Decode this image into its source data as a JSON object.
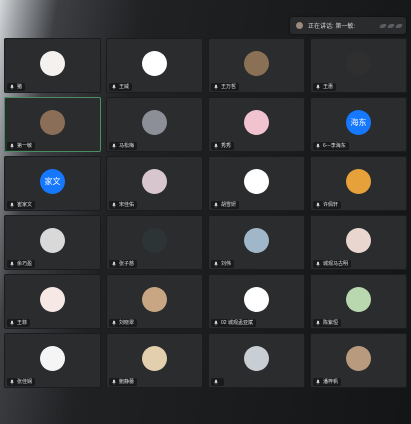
{
  "speaking_bar": {
    "text": "正在讲话: 第一敏:"
  },
  "tiles": [
    {
      "name": "猪",
      "avatar_color": "#f4f1ee",
      "avatar_text": "",
      "icon": "cartoon-girl-avatar-icon"
    },
    {
      "name": "王威",
      "avatar_color": "#ffffff",
      "avatar_text": "",
      "icon": "meh-face-avatar-icon"
    },
    {
      "name": "王万哲",
      "avatar_color": "#8a7055",
      "avatar_text": "",
      "icon": "cat-avatar-icon"
    },
    {
      "name": "王惠",
      "avatar_color": "#2f2f2f",
      "avatar_text": "",
      "icon": "dark-character-avatar-icon"
    },
    {
      "name": "第一敏",
      "avatar_color": "#8a6e58",
      "avatar_text": "",
      "icon": "desert-avatar-icon",
      "active": true
    },
    {
      "name": "马松梅",
      "avatar_color": "#8c8f97",
      "avatar_text": "",
      "icon": "figure-avatar-icon"
    },
    {
      "name": "秀秀",
      "avatar_color": "#f1c3d0",
      "avatar_text": "",
      "icon": "pink-cartoon-avatar-icon"
    },
    {
      "name": "6---李海东",
      "avatar_color": "#1677ff",
      "avatar_text": "海东",
      "icon": "text-avatar-icon"
    },
    {
      "name": "崔家文",
      "avatar_color": "#1677ff",
      "avatar_text": "家文",
      "icon": "text-avatar-icon"
    },
    {
      "name": "宋佳佑",
      "avatar_color": "#d8c6cf",
      "avatar_text": "",
      "icon": "pattern-avatar-icon"
    },
    {
      "name": "胡雪妍",
      "avatar_color": "#ffffff",
      "avatar_text": "",
      "icon": "sketch-avatar-icon"
    },
    {
      "name": "许佩轩",
      "avatar_color": "#e7a13a",
      "avatar_text": "",
      "icon": "person-avatar-icon"
    },
    {
      "name": "余巧盈",
      "avatar_color": "#d9d9d9",
      "avatar_text": "",
      "icon": "bear-avatar-icon"
    },
    {
      "name": "张子慈",
      "avatar_color": "#2d3436",
      "avatar_text": "",
      "icon": "geometric-avatar-icon"
    },
    {
      "name": "刘伟",
      "avatar_color": "#9fb7c9",
      "avatar_text": "",
      "icon": "cube-avatar-icon"
    },
    {
      "name": "城观马古明",
      "avatar_color": "#e9d6cf",
      "avatar_text": "",
      "icon": "girl-avatar-icon"
    },
    {
      "name": "王菲",
      "avatar_color": "#f6e8e4",
      "avatar_text": "",
      "icon": "ornament-avatar-icon"
    },
    {
      "name": "刘晓翠",
      "avatar_color": "#c8a683",
      "avatar_text": "",
      "icon": "dog-avatar-icon"
    },
    {
      "name": "02 城观孟亚斌",
      "avatar_color": "#ffffff",
      "avatar_text": "",
      "icon": "bunny-avatar-icon"
    },
    {
      "name": "陈紫恒",
      "avatar_color": "#b9d8b0",
      "avatar_text": "",
      "icon": "doll-avatar-icon"
    },
    {
      "name": "张佳娴",
      "avatar_color": "#f5f5f5",
      "avatar_text": "",
      "icon": "drawing-avatar-icon"
    },
    {
      "name": "鲍静蕾",
      "avatar_color": "#e3cfae",
      "avatar_text": "",
      "icon": "cat-avatar-icon"
    },
    {
      "name": "",
      "avatar_color": "#c9cdd4",
      "avatar_text": "",
      "icon": "hand-avatar-icon"
    },
    {
      "name": "潘梓帆",
      "avatar_color": "#b89a7e",
      "avatar_text": "",
      "icon": "animal-avatar-icon"
    }
  ]
}
